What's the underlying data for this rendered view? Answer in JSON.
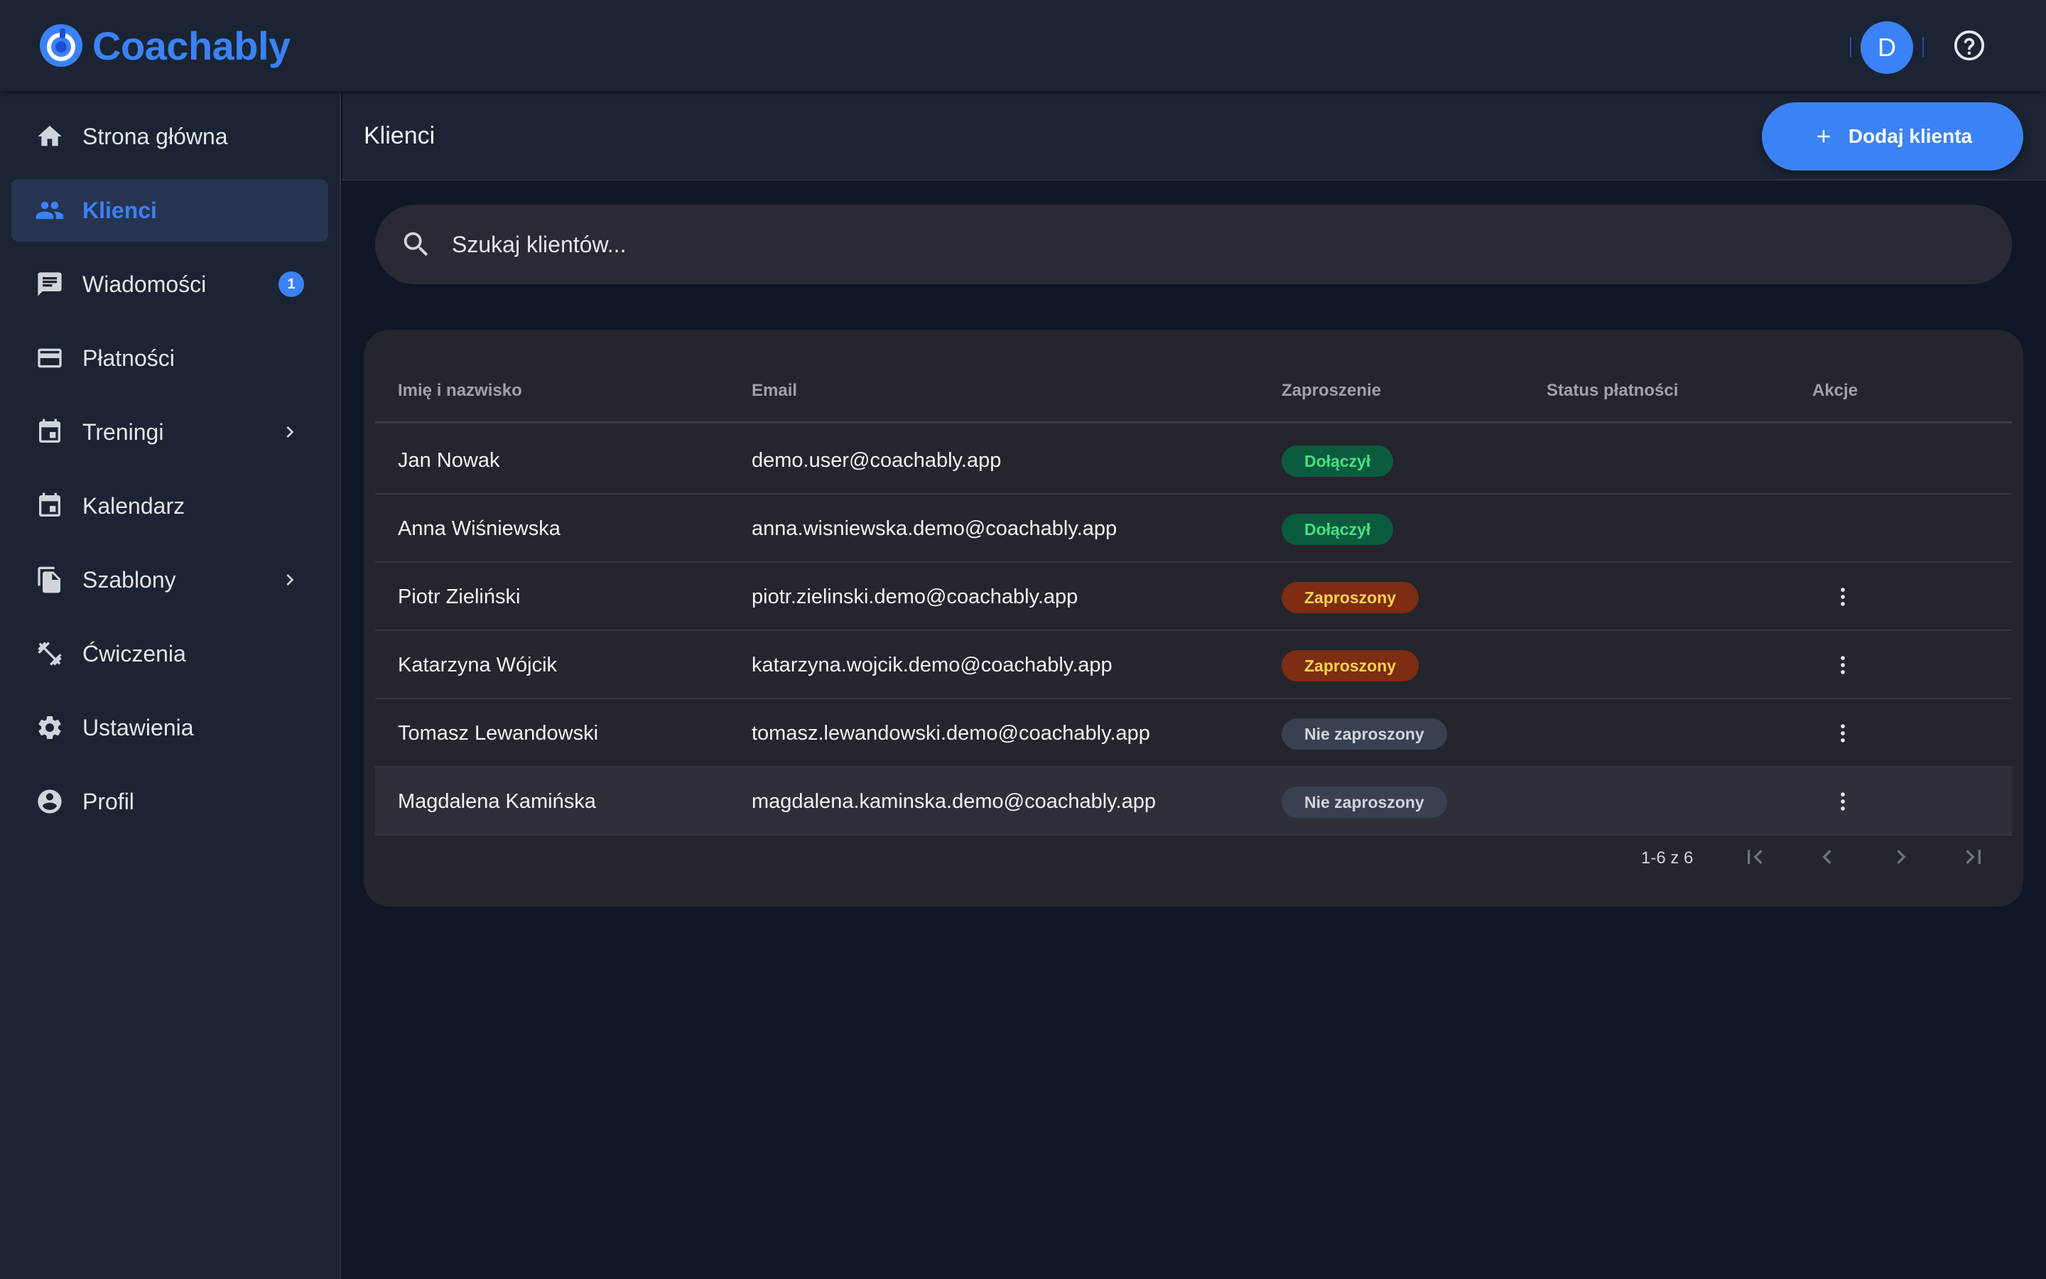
{
  "app": {
    "brand": "Coachably",
    "avatar_initial": "D",
    "accent_color": "#3b82f6"
  },
  "sidebar": {
    "items": [
      {
        "label": "Strona główna",
        "icon": "home-icon"
      },
      {
        "label": "Klienci",
        "icon": "people-icon",
        "active": true
      },
      {
        "label": "Wiadomości",
        "icon": "chat-icon",
        "badge": "1"
      },
      {
        "label": "Płatności",
        "icon": "credit-card-icon"
      },
      {
        "label": "Treningi",
        "icon": "calendar-icon",
        "expandable": true
      },
      {
        "label": "Kalendarz",
        "icon": "calendar-icon"
      },
      {
        "label": "Szablony",
        "icon": "copy-icon",
        "expandable": true
      },
      {
        "label": "Ćwiczenia",
        "icon": "dumbbell-icon"
      },
      {
        "label": "Ustawienia",
        "icon": "gear-icon"
      },
      {
        "label": "Profil",
        "icon": "account-circle-icon"
      }
    ]
  },
  "header": {
    "title": "Klienci",
    "add_button_label": "Dodaj klienta"
  },
  "search": {
    "placeholder": "Szukaj klientów..."
  },
  "table": {
    "columns": [
      "Imię i nazwisko",
      "Email",
      "Zaproszenie",
      "Status płatności",
      "Akcje"
    ],
    "rows": [
      {
        "name": "Jan Nowak",
        "email": "demo.user@coachably.app",
        "invitation": "Dołączył",
        "status_type": "joined",
        "payment_status": "",
        "has_actions": false
      },
      {
        "name": "Anna Wiśniewska",
        "email": "anna.wisniewska.demo@coachably.app",
        "invitation": "Dołączył",
        "status_type": "joined",
        "payment_status": "",
        "has_actions": false
      },
      {
        "name": "Piotr Zieliński",
        "email": "piotr.zielinski.demo@coachably.app",
        "invitation": "Zaproszony",
        "status_type": "invited",
        "payment_status": "",
        "has_actions": true
      },
      {
        "name": "Katarzyna Wójcik",
        "email": "katarzyna.wojcik.demo@coachably.app",
        "invitation": "Zaproszony",
        "status_type": "invited",
        "payment_status": "",
        "has_actions": true
      },
      {
        "name": "Tomasz Lewandowski",
        "email": "tomasz.lewandowski.demo@coachably.app",
        "invitation": "Nie zaproszony",
        "status_type": "not-invited",
        "payment_status": "",
        "has_actions": true
      },
      {
        "name": "Magdalena Kamińska",
        "email": "magdalena.kaminska.demo@coachably.app",
        "invitation": "Nie zaproszony",
        "status_type": "not-invited",
        "payment_status": "",
        "has_actions": true
      }
    ]
  },
  "pagination": {
    "range_text": "1-6 z 6"
  }
}
